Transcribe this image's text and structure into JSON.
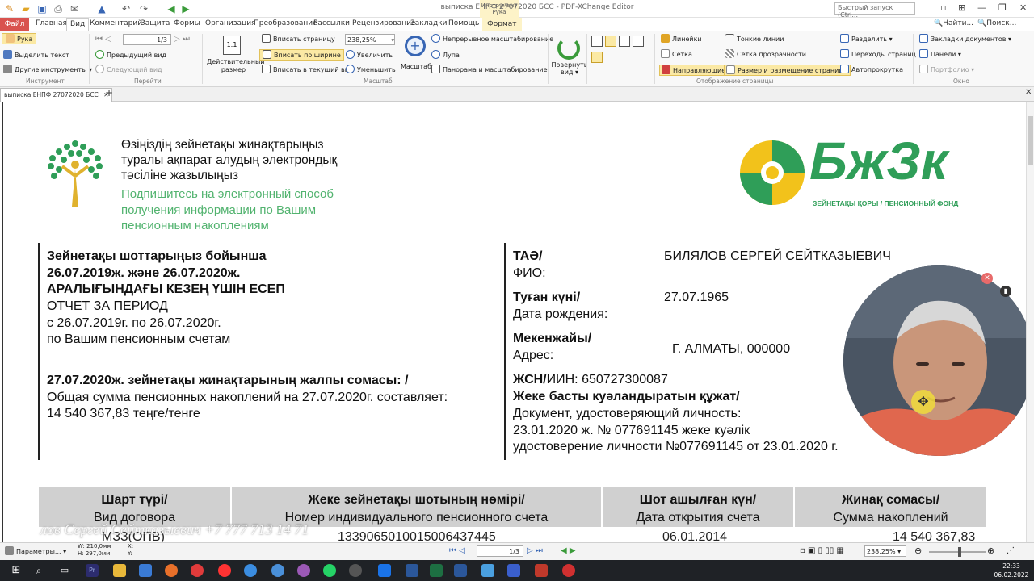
{
  "app": {
    "window_title": "выписка ЕНПФ 27072020 БСС - PDF-XChange Editor",
    "quick_search_placeholder": "Быстрый запуск (Ctrl...",
    "context_tab_header": "Инструмент Рука",
    "right_tools": [
      "Найти...",
      "Поиск..."
    ]
  },
  "menu": [
    "Файл",
    "Главная",
    "Вид",
    "Комментарий",
    "Защита",
    "Формы",
    "Организация",
    "Преобразование",
    "Рассылки",
    "Рецензирование",
    "Закладки",
    "Помощь",
    "Формат"
  ],
  "ribbon": {
    "tool": {
      "hand": "Рука",
      "select_text": "Выделить текст",
      "other_tools": "Другие инструменты",
      "group": "Инструмент"
    },
    "pages": {
      "page_field": "1/3",
      "prev_view": "Предыдущий вид",
      "next_view": "Следующий вид",
      "group": "Перейти"
    },
    "zoom": {
      "actual_size": "Действительный размер",
      "fit_page": "Вписать страницу",
      "fit_width": "Вписать по ширине",
      "fit_visible": "Вписать в текущий вид",
      "zoom_value": "238,25%",
      "zoom_in": "Увеличить",
      "zoom_out": "Уменьшить",
      "magnifier": "Масштаб",
      "continuous": "Непрерывное масштабирование",
      "loupe": "Лупа",
      "pan_zoom": "Панорама и масштабирование",
      "group": "Масштаб"
    },
    "rotate": "Повернуть вид",
    "display": {
      "rulers": "Линейки",
      "thin_lines": "Тонкие линии",
      "grid": "Сетка",
      "transparency_grid": "Сетка прозрачности",
      "guides": "Направляющие",
      "page_size": "Размер и размещение страницы",
      "split": "Разделить",
      "page_transitions": "Переходы страниц",
      "autoscroll": "Автопрокрутка",
      "group": "Отображение страницы"
    },
    "window": {
      "bookmarks": "Закладки документов",
      "panels": "Панели",
      "portfolio": "Портфолио",
      "group": "Окно"
    }
  },
  "doc_tab": "выписка ЕНПФ 27072020 БСС",
  "document": {
    "kz_header": [
      "Өзіңіздің зейнетақы жинақтарыңыз",
      "туралы ақпарат алудың электрондық",
      "тәсіліне жазылыңыз"
    ],
    "ru_header": [
      "Подпишитесь на электронный способ",
      "получения информации по Вашим",
      "пенсионным накоплениям"
    ],
    "logo_text": "БжЗк",
    "logo_subtitle": "ЗЕЙНЕТАҚЫ ҚОРЫ / ПЕНСИОННЫЙ ФОНД",
    "left": {
      "kz_title": [
        "Зейнетақы шоттарыңыз бойынша",
        "26.07.2019ж. және 26.07.2020ж.",
        "АРАЛЫҒЫНДАҒЫ КЕЗЕҢ ҮШІН ЕСЕП"
      ],
      "ru_title": [
        "ОТЧЕТ ЗА ПЕРИОД",
        "с 26.07.2019г. по 26.07.2020г.",
        "по Вашим пенсионным счетам"
      ],
      "total_kz": "27.07.2020ж. зейнетақы жинақтарының жалпы сомасы: /",
      "total_ru": "Общая сумма пенсионных накоплений на 27.07.2020г. составляет:",
      "total_value": "14 540 367,83 теңге/тенге"
    },
    "right": {
      "fio_kz": "ТАӘ/",
      "fio_ru": "ФИО:",
      "fio_value": "БИЛЯЛОВ СЕРГЕЙ СЕЙТКАЗЫЕВИЧ",
      "dob_kz": "Туған күні/",
      "dob_ru": "Дата рождения:",
      "dob_value": "27.07.1965",
      "addr_kz": "Мекенжайы/",
      "addr_ru": "Адрес:",
      "addr_value": "Г. АЛМАТЫ, 000000",
      "iin_kz": "ЖСН/",
      "iin_rest": "ИИН: 650727300087",
      "id_kz": "Жеке басты куәландыратын құжат/",
      "id_ru": "Документ, удостоверяющий личность:",
      "id_line1": "23.01.2020 ж.  № 077691145 жеке куәлік",
      "id_line2": "удостоверение личности  №077691145 от 23.01.2020 г."
    },
    "table": {
      "headers": [
        {
          "kz": "Шарт түрі/",
          "ru": "Вид договора"
        },
        {
          "kz": "Жеке зейнетақы шотының нөмірі/",
          "ru": "Номер индивидуального пенсионного счета"
        },
        {
          "kz": "Шот ашылған күн/",
          "ru": "Дата открытия счета"
        },
        {
          "kz": "Жинақ сомасы/",
          "ru": "Сумма накоплений"
        }
      ],
      "row": [
        "МЗЗ(ОПВ)",
        "1339065010015006437445",
        "06.01.2014",
        "14 540 367,83"
      ]
    },
    "watermark": "лов Сергей Сейтказыевич +7 777 713 14 71"
  },
  "statusbar": {
    "params": "Параметры...",
    "width": "W: 210,0мм",
    "height": "H: 297,0мм",
    "x": "X:",
    "y": "Y:",
    "page": "1/3",
    "zoom": "238,25%"
  },
  "taskbar": {
    "time": "22:33",
    "date": "06.02.2022"
  }
}
